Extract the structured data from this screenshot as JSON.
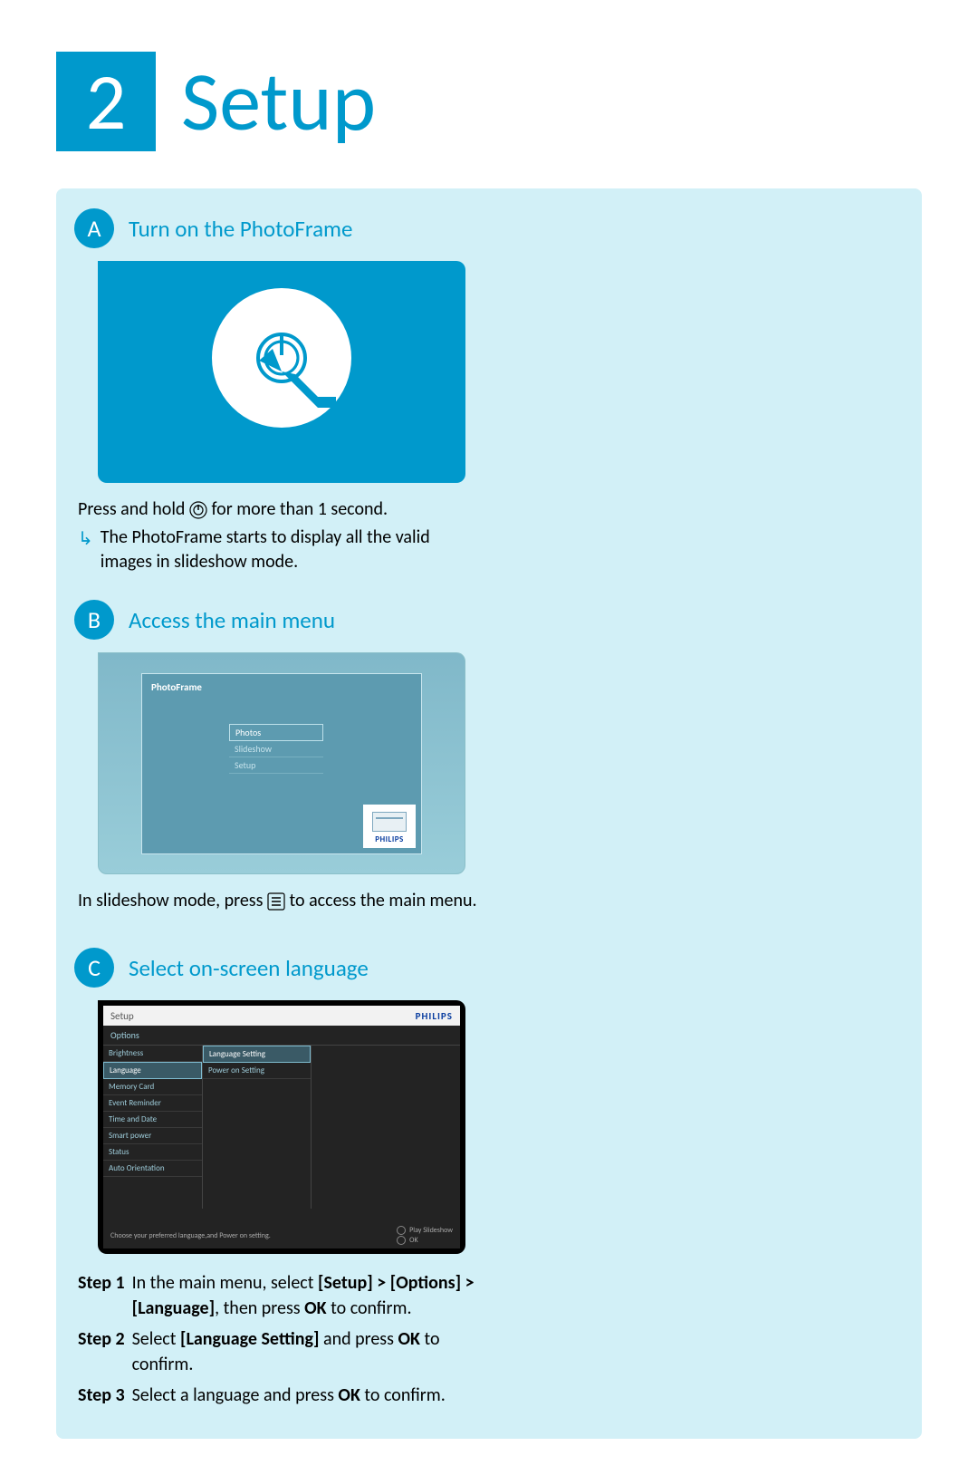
{
  "header": {
    "number": "2",
    "title": "Setup"
  },
  "sectionA": {
    "letter": "A",
    "title": "Turn on the PhotoFrame",
    "instr_pre": "Press and hold ",
    "instr_post": " for more than 1 second.",
    "result": "The PhotoFrame starts to display all the valid images in slideshow mode."
  },
  "sectionB": {
    "letter": "B",
    "title": "Access the main menu",
    "screen_title": "PhotoFrame",
    "menu_items": [
      "Photos",
      "Slideshow",
      "Setup"
    ],
    "philips": "PHILIPS",
    "instr_pre": "In slideshow mode, press ",
    "instr_post": " to  access the main menu."
  },
  "sectionC": {
    "letter": "C",
    "title": "Select on-screen language",
    "screen": {
      "top_left": "Setup",
      "philips": "PHILIPS",
      "options_label": "Options",
      "left_items": [
        "Brightness",
        "Language",
        "Memory Card",
        "Event Reminder",
        "Time and Date",
        "Smart power",
        "Status",
        "Auto Orientation"
      ],
      "right_items": [
        "Language Setting",
        "Power on Setting"
      ],
      "hint": "Choose your preferred language,and Power on setting.",
      "play": "Play Slideshow",
      "ok": "OK"
    },
    "steps": [
      {
        "label": "Step 1",
        "pre": "In the main menu, select ",
        "bold1": "[Setup] > [Options] > [Language]",
        "mid": ", then press ",
        "bold2": "OK",
        "post": " to confirm."
      },
      {
        "label": "Step 2",
        "pre": "Select ",
        "bold1": "[Language Setting]",
        "mid": " and press ",
        "bold2": "OK",
        "post": " to confirm."
      },
      {
        "label": "Step 3",
        "pre": "Select a language and press ",
        "bold1": "OK",
        "mid": " to confirm.",
        "bold2": "",
        "post": ""
      }
    ]
  }
}
